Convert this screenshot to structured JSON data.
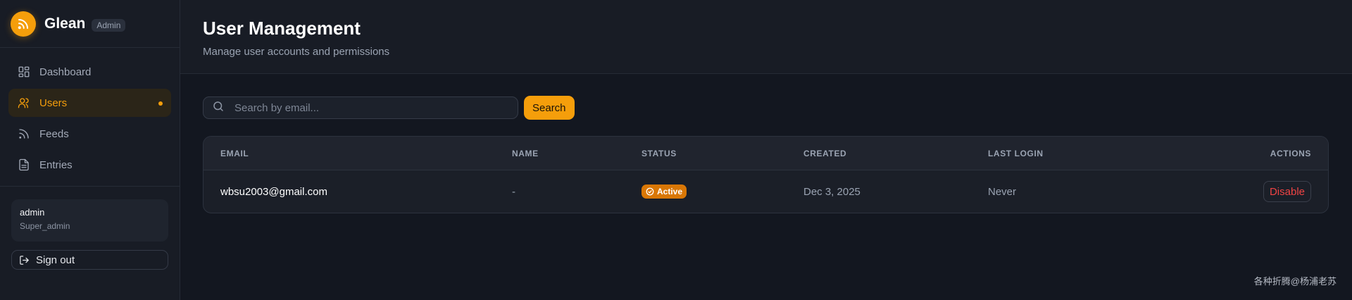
{
  "sidebar": {
    "brand": {
      "name": "Glean",
      "badge": "Admin"
    },
    "items": [
      {
        "label": "Dashboard",
        "icon": "dashboard-icon"
      },
      {
        "label": "Users",
        "icon": "users-icon",
        "active": true
      },
      {
        "label": "Feeds",
        "icon": "rss-icon"
      },
      {
        "label": "Entries",
        "icon": "document-icon"
      }
    ],
    "user": {
      "name": "admin",
      "role": "Super_admin"
    },
    "signout_label": "Sign out"
  },
  "header": {
    "title": "User Management",
    "subtitle": "Manage user accounts and permissions"
  },
  "search": {
    "placeholder": "Search by email...",
    "value": "",
    "button_label": "Search"
  },
  "table": {
    "columns": [
      "EMAIL",
      "NAME",
      "STATUS",
      "CREATED",
      "LAST LOGIN",
      "ACTIONS"
    ],
    "rows": [
      {
        "email": "wbsu2003@gmail.com",
        "name": "-",
        "status": "Active",
        "created": "Dec 3, 2025",
        "last_login": "Never",
        "action": "Disable"
      }
    ]
  },
  "watermark": "各种折腾@杨浦老苏",
  "colors": {
    "accent": "#f59e0b",
    "background": "#131720",
    "danger": "#ef4444"
  }
}
